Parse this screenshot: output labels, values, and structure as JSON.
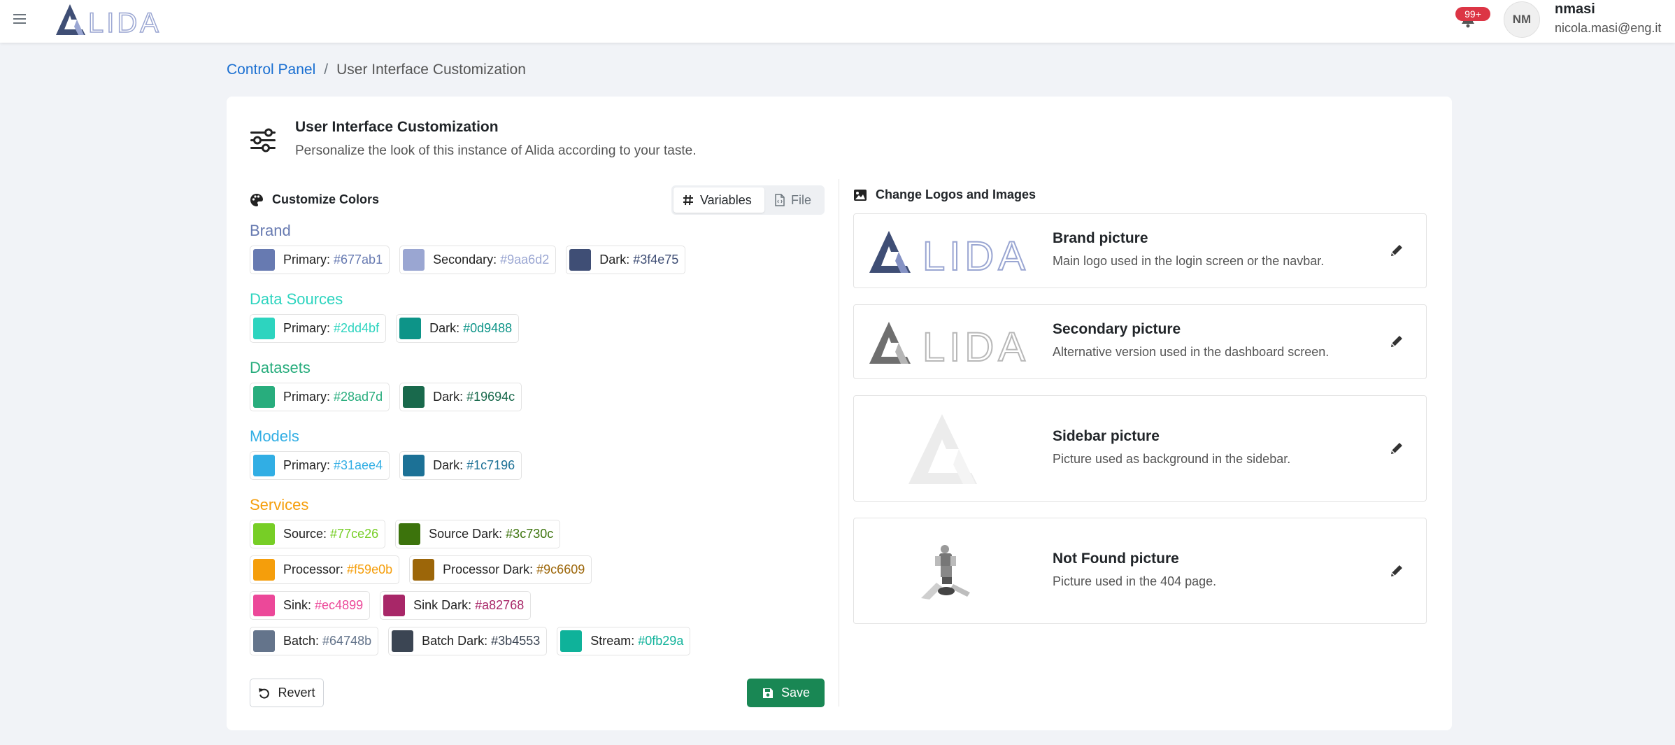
{
  "navbar": {
    "notifications": "99+",
    "avatar_initials": "NM",
    "username": "nmasi",
    "email": "nicola.masi@eng.it"
  },
  "breadcrumb": {
    "root": "Control Panel",
    "separator": "/",
    "current": "User Interface Customization"
  },
  "page": {
    "title": "User Interface Customization",
    "subtitle": "Personalize the look of this instance of Alida according to your taste."
  },
  "colors_section": {
    "heading": "Customize Colors",
    "toggle": {
      "variables": "Variables",
      "file": "File",
      "selected": "Variables"
    },
    "groups": [
      {
        "label": "Brand",
        "label_color": "#677ab1",
        "colors": [
          {
            "label": "Primary:",
            "value": "#677ab1"
          },
          {
            "label": "Secondary:",
            "value": "#9aa6d2"
          },
          {
            "label": "Dark:",
            "value": "#3f4e75"
          }
        ]
      },
      {
        "label": "Data Sources",
        "label_color": "#2dd4bf",
        "colors": [
          {
            "label": "Primary:",
            "value": "#2dd4bf"
          },
          {
            "label": "Dark:",
            "value": "#0d9488"
          }
        ]
      },
      {
        "label": "Datasets",
        "label_color": "#28ad7d",
        "colors": [
          {
            "label": "Primary:",
            "value": "#28ad7d"
          },
          {
            "label": "Dark:",
            "value": "#19694c"
          }
        ]
      },
      {
        "label": "Models",
        "label_color": "#31aee4",
        "colors": [
          {
            "label": "Primary:",
            "value": "#31aee4"
          },
          {
            "label": "Dark:",
            "value": "#1c7196"
          }
        ]
      },
      {
        "label": "Services",
        "label_color": "#f59e0b",
        "colors": [
          {
            "label": "Source:",
            "value": "#77ce26"
          },
          {
            "label": "Source Dark:",
            "value": "#3c730c"
          },
          {
            "label": "Processor:",
            "value": "#f59e0b"
          },
          {
            "label": "Processor Dark:",
            "value": "#9c6609"
          },
          {
            "label": "Sink:",
            "value": "#ec4899"
          },
          {
            "label": "Sink Dark:",
            "value": "#a82768"
          },
          {
            "label": "Batch:",
            "value": "#64748b"
          },
          {
            "label": "Batch Dark:",
            "value": "#3b4553"
          },
          {
            "label": "Stream:",
            "value": "#0fb29a"
          }
        ]
      }
    ],
    "revert_label": "Revert",
    "save_label": "Save"
  },
  "pictures_section": {
    "heading": "Change Logos and Images",
    "items": [
      {
        "title": "Brand picture",
        "description": "Main logo used in the login screen or the navbar."
      },
      {
        "title": "Secondary picture",
        "description": "Alternative version used in the dashboard screen."
      },
      {
        "title": "Sidebar picture",
        "description": "Picture used as background in the sidebar."
      },
      {
        "title": "Not Found picture",
        "description": "Picture used in the 404 page."
      }
    ]
  },
  "logo_text": "LIDA",
  "icons": [
    "menu-icon",
    "bell-icon",
    "sliders-icon",
    "palette-icon",
    "hash-icon",
    "file-icon",
    "image-icon",
    "pencil-icon",
    "undo-icon",
    "save-icon"
  ]
}
